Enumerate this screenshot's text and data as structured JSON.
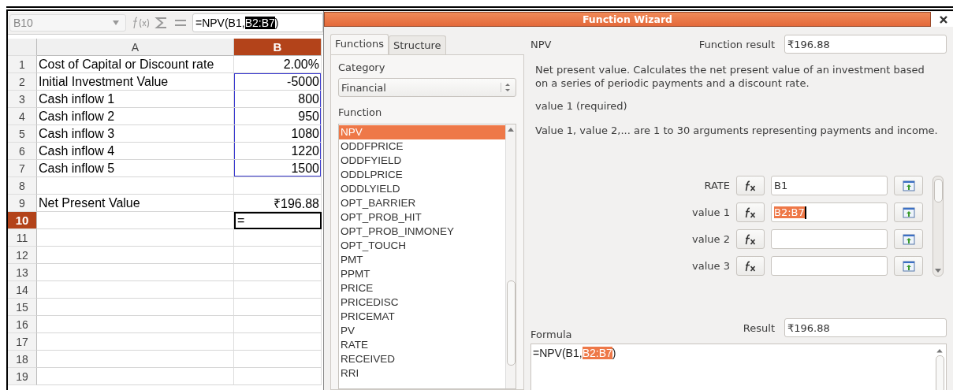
{
  "sheet": {
    "name_box": "B10",
    "formula_bar": {
      "before": "=NPV(B1,",
      "selected": "B2:B7",
      "after": ")"
    },
    "columns": [
      {
        "label": "A",
        "selected": false
      },
      {
        "label": "B",
        "selected": true
      }
    ],
    "rows": [
      {
        "number": "1",
        "a": "Cost of Capital or Discount rate",
        "b": "2.00%",
        "selected": false,
        "referenced": false
      },
      {
        "number": "2",
        "a": "Initial Investment Value",
        "b": "-5000",
        "selected": false,
        "referenced": true
      },
      {
        "number": "3",
        "a": "Cash inflow 1",
        "b": "800",
        "selected": false,
        "referenced": true
      },
      {
        "number": "4",
        "a": "Cash inflow 2",
        "b": "950",
        "selected": false,
        "referenced": true
      },
      {
        "number": "5",
        "a": "Cash inflow 3",
        "b": "1080",
        "selected": false,
        "referenced": true
      },
      {
        "number": "6",
        "a": "Cash inflow 4",
        "b": "1220",
        "selected": false,
        "referenced": true
      },
      {
        "number": "7",
        "a": "Cash inflow 5",
        "b": "1500",
        "selected": false,
        "referenced": true
      },
      {
        "number": "8",
        "selected": false,
        "referenced": false
      },
      {
        "number": "9",
        "a": "Net Present Value",
        "b": "₹196.88",
        "selected": false,
        "referenced": false
      },
      {
        "number": "10",
        "b": "=",
        "selected": true,
        "referenced": false
      },
      {
        "number": "11",
        "selected": false,
        "referenced": false
      },
      {
        "number": "12",
        "selected": false,
        "referenced": false
      },
      {
        "number": "13",
        "selected": false,
        "referenced": false
      },
      {
        "number": "14",
        "selected": false,
        "referenced": false
      },
      {
        "number": "15",
        "selected": false,
        "referenced": false
      },
      {
        "number": "16",
        "selected": false,
        "referenced": false
      },
      {
        "number": "17",
        "selected": false,
        "referenced": false
      },
      {
        "number": "18",
        "selected": false,
        "referenced": false
      },
      {
        "number": "19",
        "selected": false,
        "referenced": false
      }
    ]
  },
  "dialog": {
    "title": "Function Wizard",
    "tabs": [
      {
        "label": "Functions",
        "selected": true
      },
      {
        "label": "Structure",
        "selected": false
      }
    ],
    "category_label": "Category",
    "category": "Financial",
    "function_label": "Function",
    "functions": [
      {
        "name": "NPV",
        "selected": true
      },
      {
        "name": "ODDFPRICE",
        "selected": false
      },
      {
        "name": "ODDFYIELD",
        "selected": false
      },
      {
        "name": "ODDLPRICE",
        "selected": false
      },
      {
        "name": "ODDLYIELD",
        "selected": false
      },
      {
        "name": "OPT_BARRIER",
        "selected": false
      },
      {
        "name": "OPT_PROB_HIT",
        "selected": false
      },
      {
        "name": "OPT_PROB_INMONEY",
        "selected": false
      },
      {
        "name": "OPT_TOUCH",
        "selected": false
      },
      {
        "name": "PMT",
        "selected": false
      },
      {
        "name": "PPMT",
        "selected": false
      },
      {
        "name": "PRICE",
        "selected": false
      },
      {
        "name": "PRICEDISC",
        "selected": false
      },
      {
        "name": "PRICEMAT",
        "selected": false
      },
      {
        "name": "PV",
        "selected": false
      },
      {
        "name": "RATE",
        "selected": false
      },
      {
        "name": "RECEIVED",
        "selected": false
      },
      {
        "name": "RRI",
        "selected": false
      }
    ],
    "function_name": "NPV",
    "function_result_label": "Function result",
    "function_result": "₹196.88",
    "description": "Net present value. Calculates the net present value of an investment based on a series of periodic payments and a discount rate.",
    "argument_title": "value 1 (required)",
    "argument_description": "Value 1, value 2,... are 1 to 30 arguments representing payments and income.",
    "arguments": [
      {
        "label": "RATE",
        "value": "B1",
        "highlighted": false
      },
      {
        "label": "value 1",
        "value": "B2:B7",
        "highlighted": true
      },
      {
        "label": "value 2",
        "highlighted": false
      },
      {
        "label": "value 3",
        "highlighted": false
      }
    ],
    "formula_label": "Formula",
    "result_label": "Result",
    "result": "₹196.88",
    "formula": {
      "before": "=NPV(B1,",
      "selected": "B2:B7",
      "after": ")"
    }
  }
}
